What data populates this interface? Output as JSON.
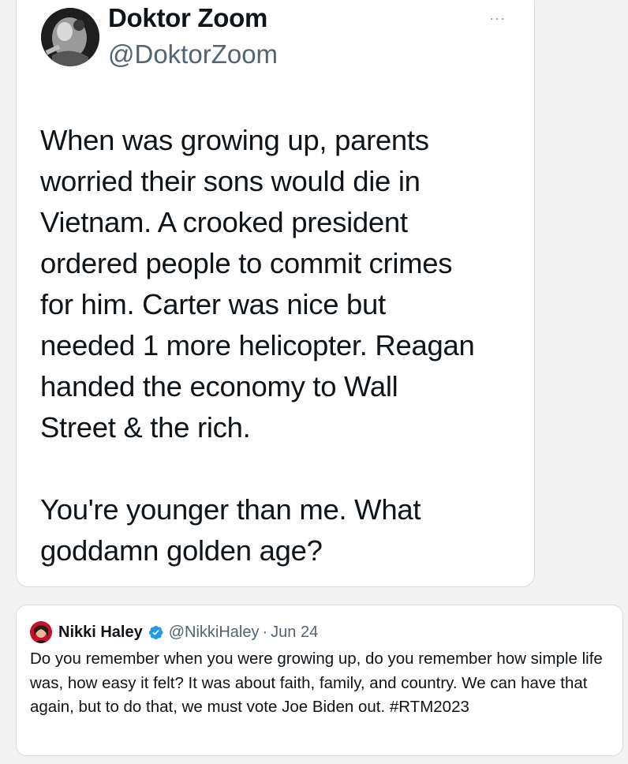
{
  "main_tweet": {
    "author_name": "Doktor Zoom",
    "author_handle": "@DoktorZoom",
    "more_label": "···",
    "text": "When was growing up, parents\nworried their sons would die in\nVietnam. A crooked president\nordered people to commit crimes\nfor him. Carter was nice but\nneeded 1 more helicopter. Reagan\nhanded the economy to Wall\nStreet & the rich.\n\nYou're younger than me. What\ngoddamn golden age?"
  },
  "quoted_tweet": {
    "author_name": "Nikki Haley",
    "author_handle": "@NikkiHaley",
    "separator": "·",
    "date": "Jun 24",
    "text": "Do you remember when you were growing up, do you remember how simple life was, how easy it felt? It was about faith, family, and country. We can have that again, but to do that, we must vote Joe Biden out. #RTM2023"
  },
  "colors": {
    "verified_badge": "#1d9bf0",
    "secondary_text": "#536471",
    "card_border": "#d9dde1"
  },
  "icons": [
    "more-icon",
    "verified-icon"
  ]
}
